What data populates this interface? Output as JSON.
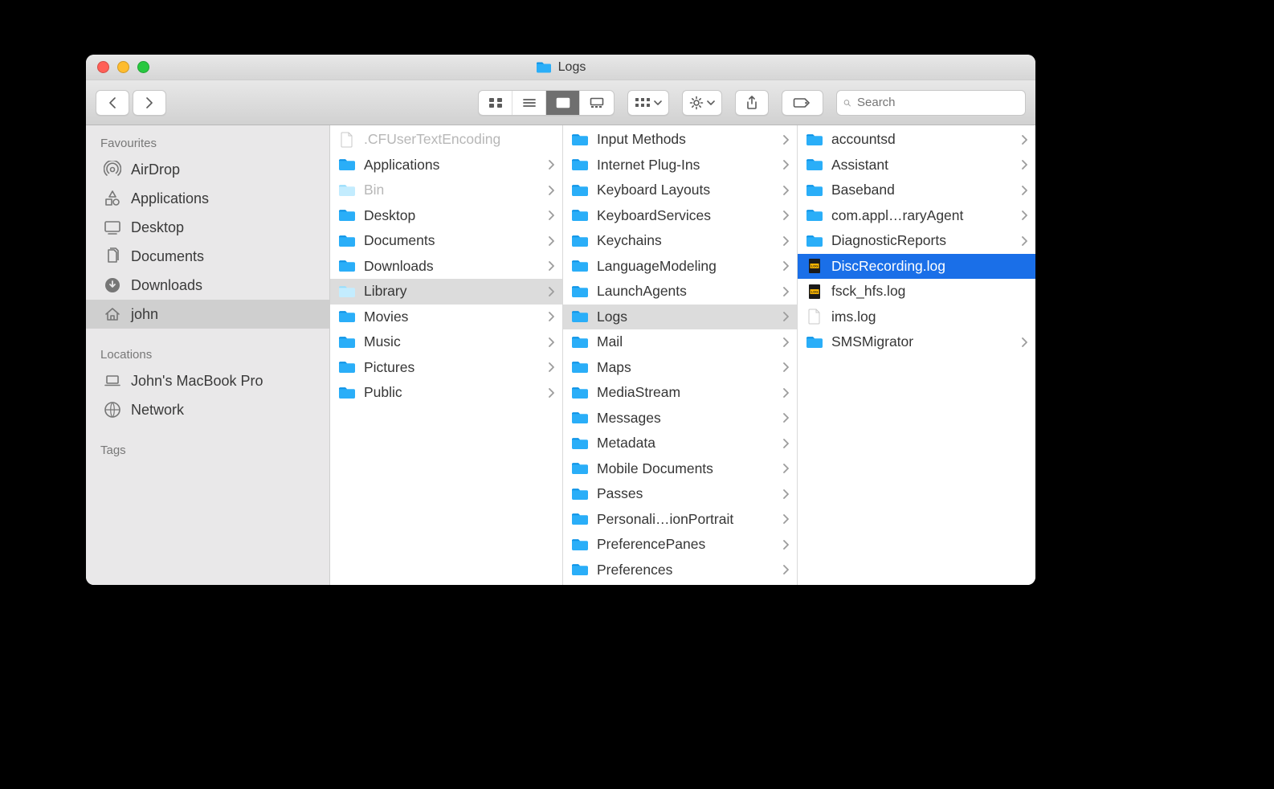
{
  "window": {
    "title": "Logs"
  },
  "toolbar": {
    "search_placeholder": "Search"
  },
  "sidebar": {
    "sections": [
      {
        "title": "Favourites",
        "items": [
          {
            "icon": "airdrop",
            "label": "AirDrop"
          },
          {
            "icon": "apps",
            "label": "Applications"
          },
          {
            "icon": "desktop",
            "label": "Desktop"
          },
          {
            "icon": "documents",
            "label": "Documents"
          },
          {
            "icon": "downloads",
            "label": "Downloads"
          },
          {
            "icon": "home",
            "label": "john",
            "selected": true
          }
        ]
      },
      {
        "title": "Locations",
        "items": [
          {
            "icon": "laptop",
            "label": "John's MacBook Pro"
          },
          {
            "icon": "network",
            "label": "Network"
          }
        ]
      },
      {
        "title": "Tags",
        "items": []
      }
    ]
  },
  "columns": [
    {
      "items": [
        {
          "type": "file",
          "label": ".CFUserTextEncoding",
          "muted": true
        },
        {
          "type": "folder",
          "label": "Applications",
          "arrow": true
        },
        {
          "type": "folder",
          "label": "Bin",
          "arrow": true,
          "muted": true,
          "variant": "light"
        },
        {
          "type": "folder",
          "label": "Desktop",
          "arrow": true
        },
        {
          "type": "folder",
          "label": "Documents",
          "arrow": true
        },
        {
          "type": "folder",
          "label": "Downloads",
          "arrow": true
        },
        {
          "type": "folder",
          "label": "Library",
          "arrow": true,
          "path_selected": true,
          "variant": "light"
        },
        {
          "type": "folder",
          "label": "Movies",
          "arrow": true
        },
        {
          "type": "folder",
          "label": "Music",
          "arrow": true
        },
        {
          "type": "folder",
          "label": "Pictures",
          "arrow": true
        },
        {
          "type": "folder",
          "label": "Public",
          "arrow": true
        }
      ]
    },
    {
      "items": [
        {
          "type": "folder",
          "label": "Input Methods",
          "arrow": true
        },
        {
          "type": "folder",
          "label": "Internet Plug-Ins",
          "arrow": true
        },
        {
          "type": "folder",
          "label": "Keyboard Layouts",
          "arrow": true
        },
        {
          "type": "folder",
          "label": "KeyboardServices",
          "arrow": true
        },
        {
          "type": "folder",
          "label": "Keychains",
          "arrow": true
        },
        {
          "type": "folder",
          "label": "LanguageModeling",
          "arrow": true
        },
        {
          "type": "folder",
          "label": "LaunchAgents",
          "arrow": true
        },
        {
          "type": "folder",
          "label": "Logs",
          "arrow": true,
          "path_selected": true
        },
        {
          "type": "folder",
          "label": "Mail",
          "arrow": true
        },
        {
          "type": "folder",
          "label": "Maps",
          "arrow": true
        },
        {
          "type": "folder",
          "label": "MediaStream",
          "arrow": true
        },
        {
          "type": "folder",
          "label": "Messages",
          "arrow": true
        },
        {
          "type": "folder",
          "label": "Metadata",
          "arrow": true
        },
        {
          "type": "folder",
          "label": "Mobile Documents",
          "arrow": true
        },
        {
          "type": "folder",
          "label": "Passes",
          "arrow": true
        },
        {
          "type": "folder",
          "label": "Personali…ionPortrait",
          "arrow": true
        },
        {
          "type": "folder",
          "label": "PreferencePanes",
          "arrow": true
        },
        {
          "type": "folder",
          "label": "Preferences",
          "arrow": true
        }
      ]
    },
    {
      "items": [
        {
          "type": "folder",
          "label": "accountsd",
          "arrow": true
        },
        {
          "type": "folder",
          "label": "Assistant",
          "arrow": true
        },
        {
          "type": "folder",
          "label": "Baseband",
          "arrow": true
        },
        {
          "type": "folder",
          "label": "com.appl…raryAgent",
          "arrow": true
        },
        {
          "type": "folder",
          "label": "DiagnosticReports",
          "arrow": true
        },
        {
          "type": "log",
          "label": "DiscRecording.log",
          "selected": true
        },
        {
          "type": "log",
          "label": "fsck_hfs.log"
        },
        {
          "type": "file",
          "label": "ims.log"
        },
        {
          "type": "folder",
          "label": "SMSMigrator",
          "arrow": true
        }
      ]
    }
  ]
}
